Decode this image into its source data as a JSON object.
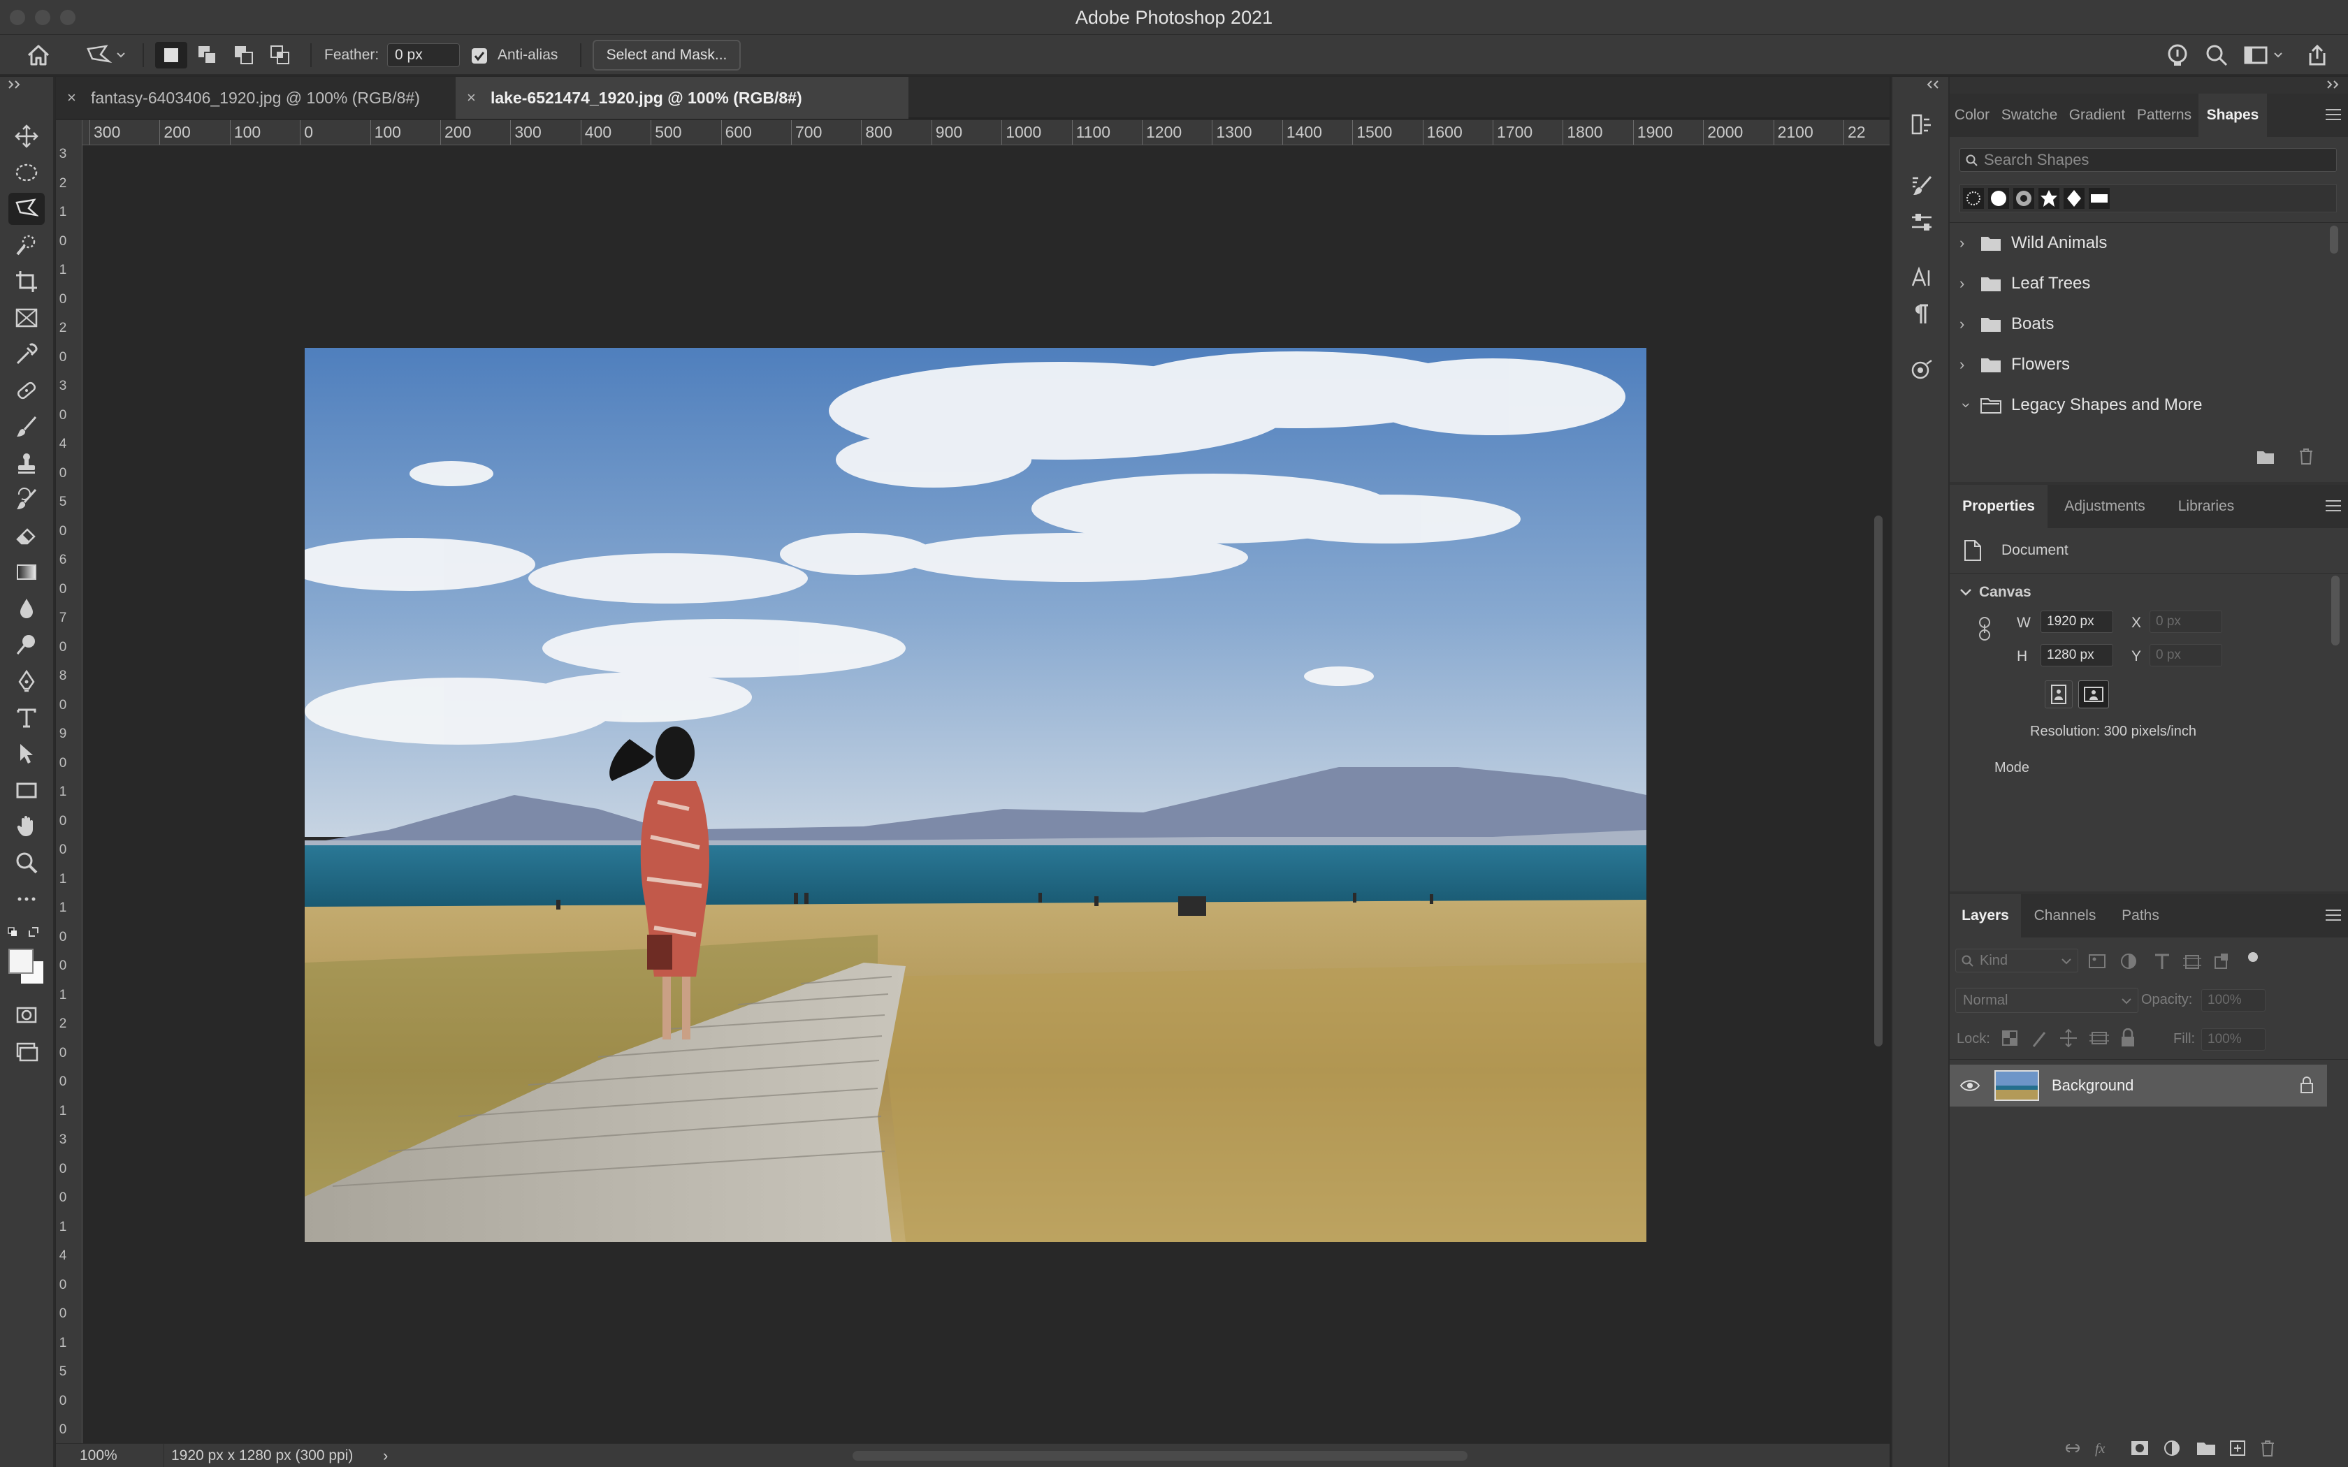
{
  "app": {
    "title": "Adobe Photoshop 2021"
  },
  "options": {
    "feather_label": "Feather:",
    "feather_value": "0 px",
    "antialias_label": "Anti-alias",
    "select_mask_label": "Select and Mask..."
  },
  "doc_tabs": [
    {
      "label": "fantasy-6403406_1920.jpg @ 100% (RGB/8#)",
      "active": false
    },
    {
      "label": "lake-6521474_1920.jpg @ 100% (RGB/8#)",
      "active": true
    }
  ],
  "ruler": {
    "h_labels": [
      "300",
      "200",
      "100",
      "0",
      "100",
      "200",
      "300",
      "400",
      "500",
      "600",
      "700",
      "800",
      "900",
      "1000",
      "1100",
      "1200",
      "1300",
      "1400",
      "1500",
      "1600",
      "1700",
      "1800",
      "1900",
      "2000",
      "2100",
      "22"
    ],
    "v_labels": [
      "3",
      "2",
      "1",
      "0",
      "1",
      "0",
      "2",
      "0",
      "3",
      "0",
      "4",
      "0",
      "5",
      "0",
      "6",
      "0",
      "7",
      "0",
      "8",
      "0",
      "9",
      "0",
      "1",
      "0",
      "0",
      "1",
      "1",
      "0",
      "0",
      "1",
      "2",
      "0",
      "0",
      "1",
      "3",
      "0",
      "0",
      "1",
      "4",
      "0",
      "0",
      "1",
      "5",
      "0",
      "0"
    ]
  },
  "status": {
    "zoom": "100%",
    "dimensions": "1920 px x 1280 px (300 ppi)",
    "arrow": "›"
  },
  "shapes_panel": {
    "tabs": [
      "Color",
      "Swatche",
      "Gradient",
      "Patterns",
      "Shapes"
    ],
    "active_tab": "Shapes",
    "search_placeholder": "Search Shapes",
    "folders": [
      {
        "label": "Wild Animals",
        "expanded": false
      },
      {
        "label": "Leaf Trees",
        "expanded": false
      },
      {
        "label": "Boats",
        "expanded": false
      },
      {
        "label": "Flowers",
        "expanded": false
      },
      {
        "label": "Legacy Shapes and More",
        "expanded": true
      }
    ]
  },
  "properties_panel": {
    "tabs": [
      "Properties",
      "Adjustments",
      "Libraries"
    ],
    "active_tab": "Properties",
    "doc_label": "Document",
    "section": "Canvas",
    "w_label": "W",
    "w_value": "1920 px",
    "h_label": "H",
    "h_value": "1280 px",
    "x_label": "X",
    "x_placeholder": "0 px",
    "y_label": "Y",
    "y_placeholder": "0 px",
    "resolution": "Resolution: 300 pixels/inch",
    "mode_label": "Mode"
  },
  "layers_panel": {
    "tabs": [
      "Layers",
      "Channels",
      "Paths"
    ],
    "active_tab": "Layers",
    "filter_placeholder": "Kind",
    "blend_mode": "Normal",
    "opacity_label": "Opacity:",
    "opacity_value": "100%",
    "lock_label": "Lock:",
    "fill_label": "Fill:",
    "fill_value": "100%",
    "layers": [
      {
        "name": "Background",
        "visible": true,
        "locked": true
      }
    ]
  },
  "colors": {
    "ui_bg": "#3a3a3a",
    "canvas_bg": "#282828",
    "panel_header": "#2f2f2f",
    "sky_top": "#5a86c0",
    "sea": "#1f6f90",
    "grass": "#b39a58"
  }
}
